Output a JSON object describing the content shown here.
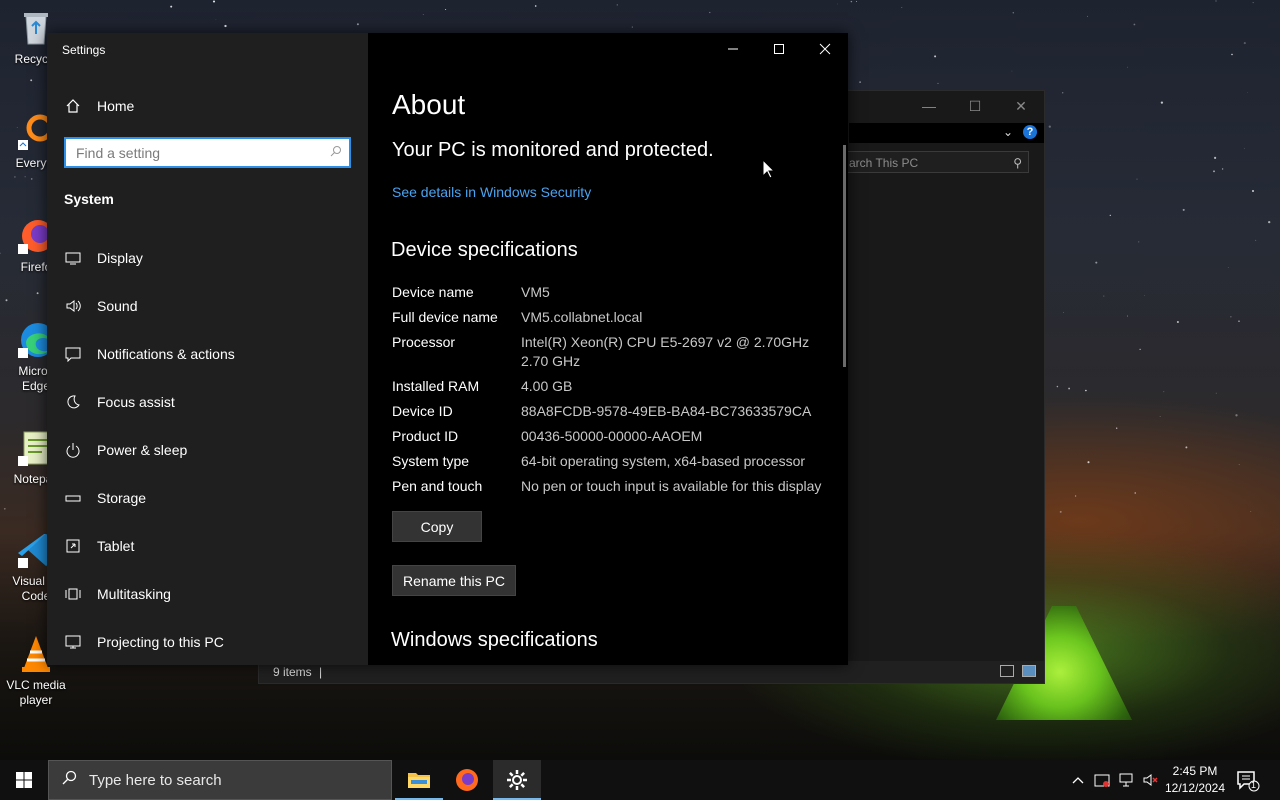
{
  "desktop": {
    "icons": [
      {
        "label": "Recycle",
        "icon": "recycle-bin-icon"
      },
      {
        "label": "Everyth",
        "icon": "everything-search-icon"
      },
      {
        "label": "Firefo",
        "icon": "firefox-icon"
      },
      {
        "label": "Micros\nEdge",
        "icon": "edge-icon"
      },
      {
        "label": "Notepac",
        "icon": "notepad-icon"
      },
      {
        "label": "Visual St\nCode",
        "icon": "vscode-icon"
      },
      {
        "label": "VLC media\nplayer",
        "icon": "vlc-icon"
      }
    ]
  },
  "explorer": {
    "search_placeholder": "arch This PC",
    "status_count": "9 items",
    "status_sep": "|"
  },
  "settings": {
    "title": "Settings",
    "home_label": "Home",
    "search_placeholder": "Find a setting",
    "section": "System",
    "nav": [
      {
        "label": "Display",
        "icon": "monitor-icon"
      },
      {
        "label": "Sound",
        "icon": "speaker-icon"
      },
      {
        "label": "Notifications & actions",
        "icon": "notification-icon"
      },
      {
        "label": "Focus assist",
        "icon": "moon-icon"
      },
      {
        "label": "Power & sleep",
        "icon": "power-icon"
      },
      {
        "label": "Storage",
        "icon": "storage-icon"
      },
      {
        "label": "Tablet",
        "icon": "tablet-icon"
      },
      {
        "label": "Multitasking",
        "icon": "multitasking-icon"
      },
      {
        "label": "Projecting to this PC",
        "icon": "projecting-icon"
      }
    ],
    "page_title": "About",
    "protect_text": "Your PC is monitored and protected.",
    "security_link": "See details in Windows Security",
    "device_specs_heading": "Device specifications",
    "specs": [
      {
        "key": "Device name",
        "value": "VM5"
      },
      {
        "key": "Full device name",
        "value": "VM5.collabnet.local"
      },
      {
        "key": "Processor",
        "value": "Intel(R) Xeon(R) CPU E5-2697 v2 @ 2.70GHz\n2.70 GHz"
      },
      {
        "key": "Installed RAM",
        "value": "4.00 GB"
      },
      {
        "key": "Device ID",
        "value": "88A8FCDB-9578-49EB-BA84-BC73633579CA"
      },
      {
        "key": "Product ID",
        "value": "00436-50000-00000-AAOEM"
      },
      {
        "key": "System type",
        "value": "64-bit operating system, x64-based processor"
      },
      {
        "key": "Pen and touch",
        "value": "No pen or touch input is available for this display"
      }
    ],
    "copy_label": "Copy",
    "rename_label": "Rename this PC",
    "windows_specs_heading": "Windows specifications"
  },
  "taskbar": {
    "search_placeholder": "Type here to search",
    "time": "2:45 PM",
    "date": "12/12/2024",
    "notification_count": "1"
  }
}
